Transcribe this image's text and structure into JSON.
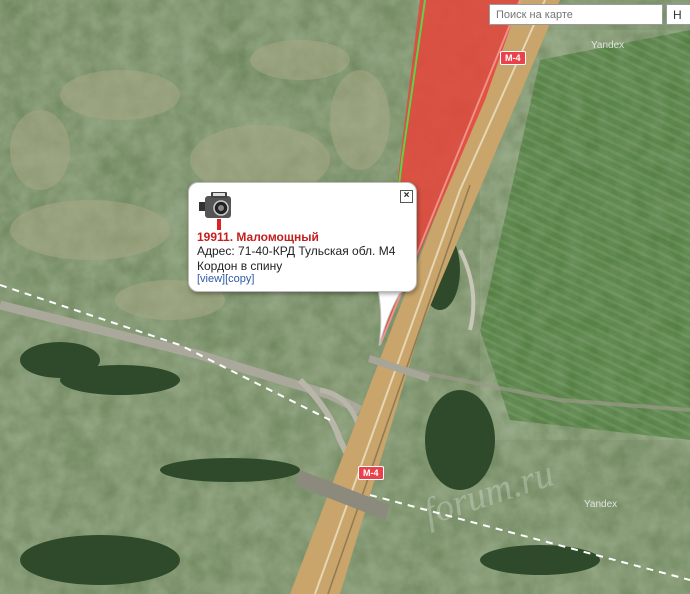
{
  "search": {
    "placeholder": "Поиск на карте",
    "button_label": "Н"
  },
  "map": {
    "road_badges": [
      "M-4",
      "M-4"
    ],
    "provider_labels": [
      "Yandex",
      "Yandex"
    ],
    "watermark": "forum.ru",
    "colors": {
      "road_highlight": "#e8443a",
      "road": "#c9a46b"
    }
  },
  "balloon": {
    "icon": "speed-camera-icon",
    "title": "19911. Маломощный",
    "address": "Адрес: 71-40-КРД Тульская обл. М4",
    "note": "Кордон в спину",
    "link_view": "[view]",
    "link_copy": "[copy]",
    "close_label": "×"
  }
}
